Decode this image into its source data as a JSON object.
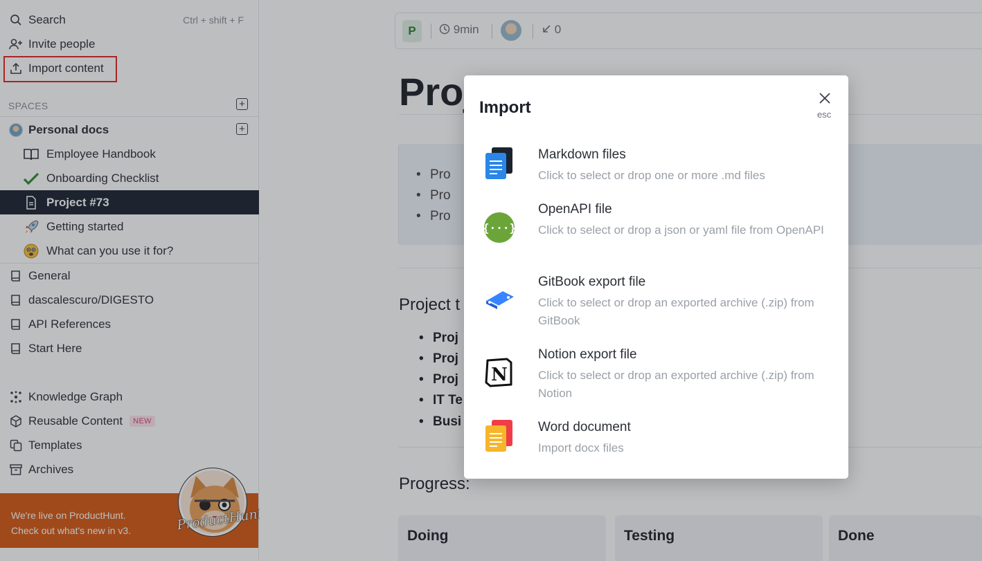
{
  "sidebar": {
    "search_label": "Search",
    "search_shortcut": "Ctrl + shift + F",
    "invite_label": "Invite people",
    "import_label": "Import content",
    "spaces_label": "SPACES",
    "space_name": "Personal docs",
    "pages": [
      {
        "label": "Employee Handbook",
        "icon": "book-icon"
      },
      {
        "label": "Onboarding Checklist",
        "icon": "check-icon"
      },
      {
        "label": "Project #73",
        "icon": "document-icon"
      },
      {
        "label": "Getting started",
        "icon": "rocket-icon"
      },
      {
        "label": "What can you use it for?",
        "icon": "face-icon"
      }
    ],
    "spaces": [
      "General",
      "dascalescuro/DIGESTO",
      "API References",
      "Start Here"
    ],
    "tools": [
      {
        "label": "Knowledge Graph",
        "icon": "graph-icon"
      },
      {
        "label": "Reusable Content",
        "icon": "cube-icon"
      },
      {
        "label": "Templates",
        "icon": "templates-icon"
      },
      {
        "label": "Archives",
        "icon": "archive-icon"
      }
    ],
    "new_badge": "NEW",
    "promo_line1": "We're live on ProductHunt.",
    "promo_line2": "Check out what's new in v3.",
    "promo_logo_text": "ProductHunt"
  },
  "doc": {
    "avatar_letter": "P",
    "read_time": "9min",
    "backlinks": "0",
    "title_visible": "Proj",
    "callout_items": [
      "Pro",
      "Pro",
      "Pro"
    ],
    "section_heading": "Project t",
    "bold_items": [
      "Proj",
      "Proj",
      "Proj",
      "IT Te",
      "Busi"
    ],
    "progress_heading": "Progress:",
    "columns": [
      "Doing",
      "Testing",
      "Done"
    ]
  },
  "modal": {
    "title": "Import",
    "close_hint": "esc",
    "options": [
      {
        "title": "Markdown files",
        "desc": "Click to select or drop one or more .md files"
      },
      {
        "title": "OpenAPI file",
        "desc": "Click to select or drop a json or yaml file from OpenAPI"
      },
      {
        "title": "GitBook export file",
        "desc": "Click to select or drop an exported archive (.zip) from GitBook"
      },
      {
        "title": "Notion export file",
        "desc": "Click to select or drop an exported archive (.zip) from Notion"
      },
      {
        "title": "Word document",
        "desc": "Import docx files"
      }
    ]
  },
  "colors": {
    "active_bg": "#1b2330",
    "highlight": "#e02424",
    "promo_bg": "#d65a14",
    "new_badge": "#e0426b"
  }
}
